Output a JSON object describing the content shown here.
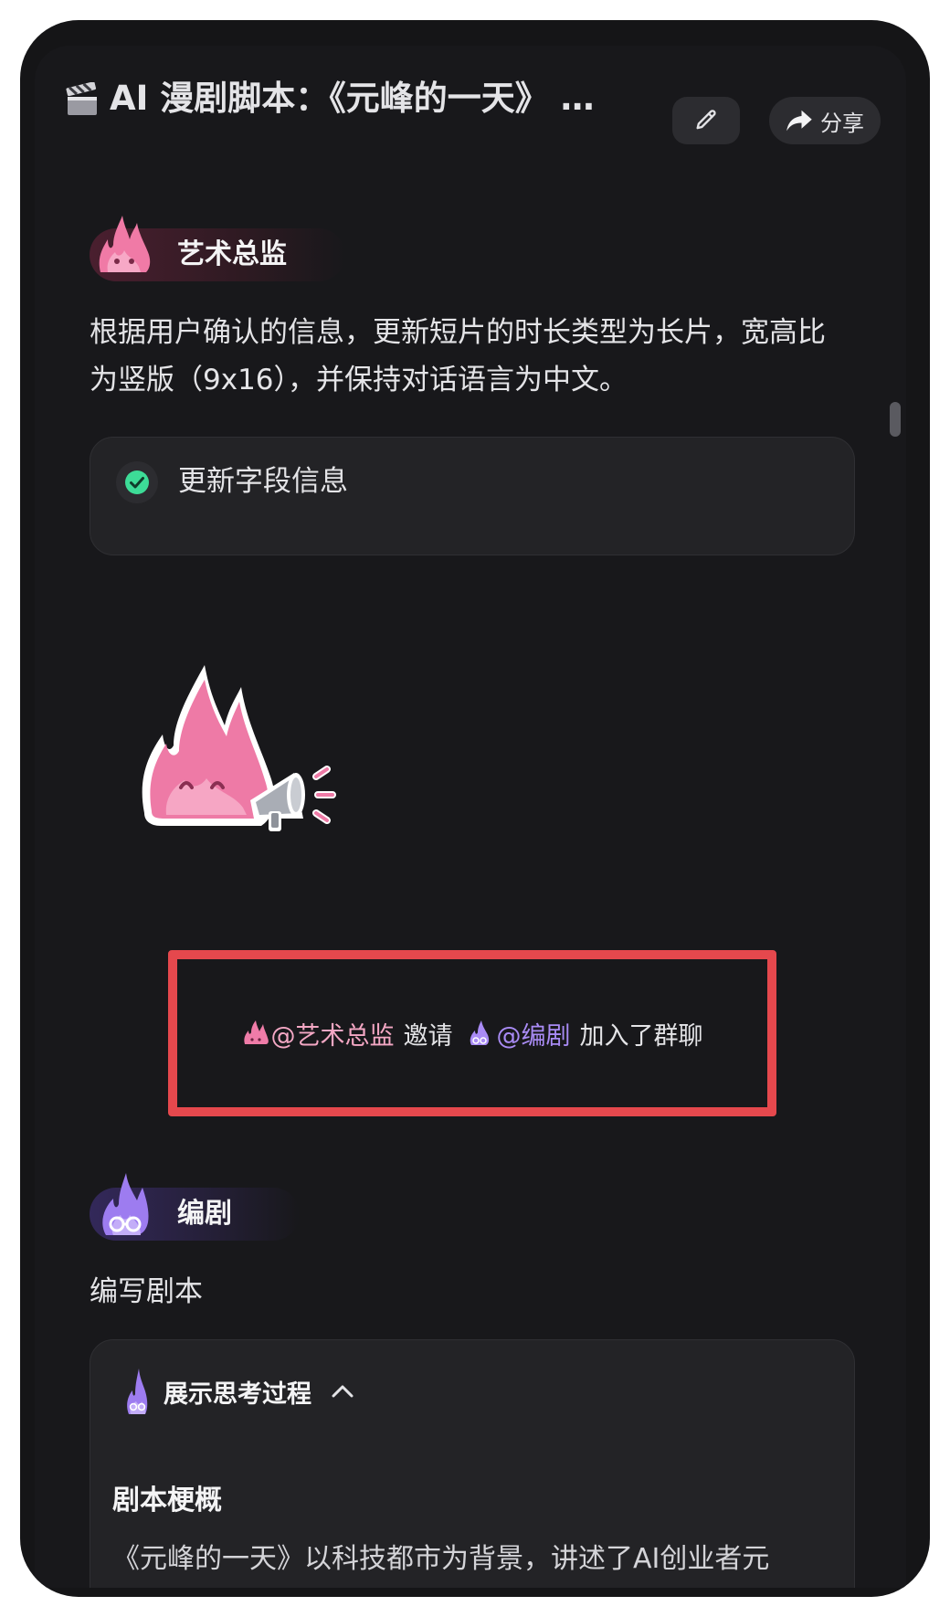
{
  "header": {
    "title": "AI 漫剧脚本：《元峰的一天》 剧本创作",
    "share_label": "分享"
  },
  "messages": [
    {
      "agent": "艺术总监",
      "text": "根据用户确认的信息，更新短片的时长类型为长片，宽高比为竖版（9x16），并保持对话语言为中文。",
      "tool_call": {
        "label": "更新字段信息",
        "status": "done"
      }
    },
    {
      "agent": "编剧",
      "text": "编写剧本"
    }
  ],
  "system_event": {
    "inviter": "@艺术总监",
    "verb": "邀请",
    "invitee": "@编剧",
    "suffix": "加入了群聊"
  },
  "thinking": {
    "toggle_label": "展示思考过程",
    "section_title": "剧本梗概",
    "preview": "《元峰的一天》以科技都市为背景，讲述了AI创业者元"
  },
  "icons": {
    "title": "clapperboard-icon",
    "edit": "pencil-icon",
    "share": "share-arrow-icon",
    "check": "check-circle-icon",
    "toggle": "chevron-up-icon"
  },
  "colors": {
    "accent_pink": "#f4a7c4",
    "accent_purple": "#a98bf5",
    "success": "#3ddc97",
    "highlight_border": "#e5484d"
  }
}
